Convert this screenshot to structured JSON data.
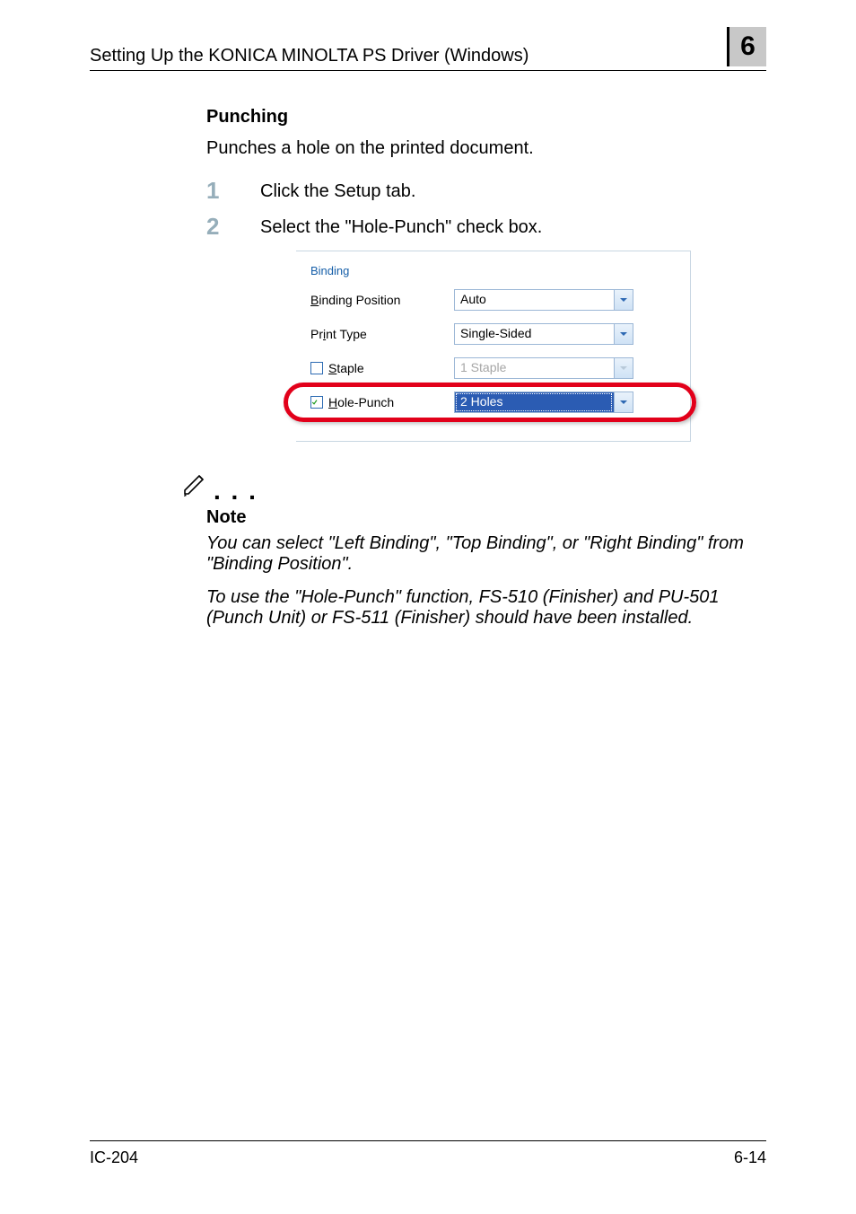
{
  "header": {
    "title": "Setting Up the KONICA MINOLTA PS Driver (Windows)",
    "chapter": "6"
  },
  "section": {
    "heading": "Punching",
    "intro": "Punches a hole on the printed document."
  },
  "steps": {
    "s1_num": "1",
    "s1_text": "Click the Setup tab.",
    "s2_num": "2",
    "s2_text": "Select the \"Hole-Punch\" check box."
  },
  "binding_panel": {
    "group_label": "Binding",
    "binding_position": {
      "label_pre": "B",
      "label_post": "inding Position",
      "value": "Auto"
    },
    "print_type": {
      "label_pre": "Pr",
      "label_u": "i",
      "label_post": "nt Type",
      "value": "Single-Sided"
    },
    "staple": {
      "label_pre": "S",
      "label_post": "taple",
      "value": "1 Staple"
    },
    "hole_punch": {
      "label_pre": "H",
      "label_post": "ole-Punch",
      "value": "2 Holes"
    }
  },
  "note": {
    "heading": "Note",
    "p1": "You can select \"Left Binding\", \"Top Binding\", or \"Right Binding\" from \"Binding Position\".",
    "p2": "To use the \"Hole-Punch\" function, FS-510 (Finisher) and PU-501 (Punch Unit) or FS-511 (Finisher) should have been installed."
  },
  "footer": {
    "left": "IC-204",
    "right": "6-14"
  }
}
